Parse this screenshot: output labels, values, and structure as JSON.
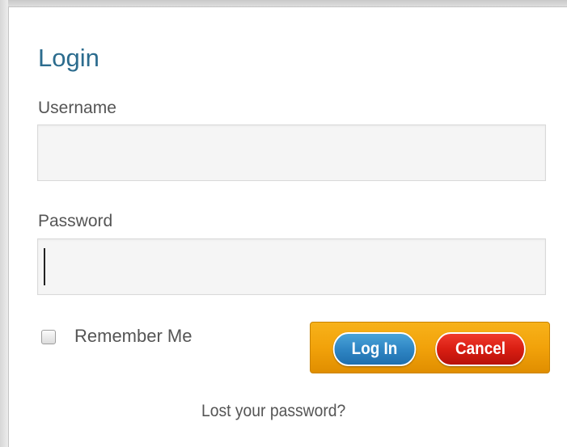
{
  "dialog": {
    "title": "Login"
  },
  "username": {
    "label": "Username",
    "value": "",
    "placeholder": ""
  },
  "password": {
    "label": "Password",
    "value": "",
    "placeholder": ""
  },
  "remember": {
    "label": "Remember Me",
    "checked": false
  },
  "buttons": {
    "login_label": "Log In",
    "cancel_label": "Cancel"
  },
  "links": {
    "lost_password": "Lost your password?"
  },
  "colors": {
    "title": "#2c6c8e",
    "button_bar": "#f2a20a",
    "login_button": "#2f86c4",
    "cancel_button": "#d91e12"
  }
}
